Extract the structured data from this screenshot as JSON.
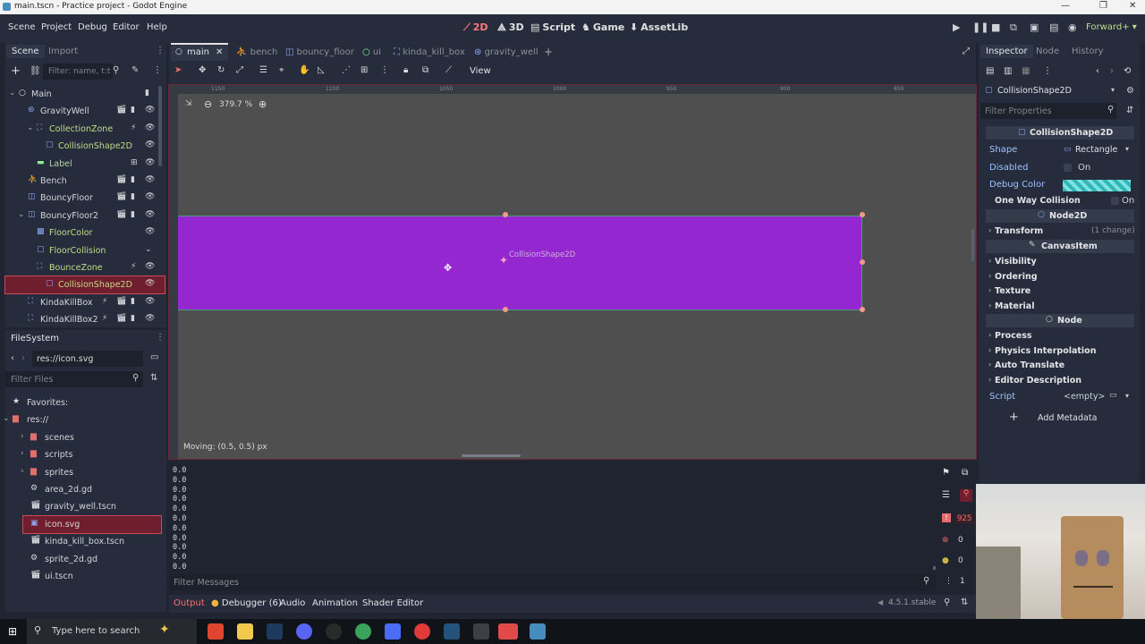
{
  "title_bar": {
    "title": "main.tscn - Practice project - Godot Engine"
  },
  "menu": [
    "Scene",
    "Project",
    "Debug",
    "Editor",
    "Help"
  ],
  "workspaces": [
    {
      "icon": "2D-icon",
      "label": "2D",
      "active": true
    },
    {
      "icon": "3D-icon",
      "label": "3D"
    },
    {
      "icon": "script-icon",
      "label": "Script"
    },
    {
      "icon": "game-icon",
      "label": "Game"
    },
    {
      "icon": "assetlib-icon",
      "label": "AssetLib"
    }
  ],
  "renderer": "Forward+",
  "scene_panel": {
    "tabs": [
      "Scene",
      "Import"
    ],
    "filter_placeholder": "Filter: name, t:t",
    "nodes": [
      {
        "label": "Main",
        "depth": 0,
        "icon_color": "#e0e0e0"
      },
      {
        "label": "GravityWell",
        "depth": 1,
        "icon_color": "#8da5f3"
      },
      {
        "label": "CollectionZone",
        "depth": 2,
        "icon_color": "#8da5f3",
        "accent": true
      },
      {
        "label": "CollisionShape2D",
        "depth": 3,
        "icon_color": "#8da5f3",
        "accent": true
      },
      {
        "label": "Label",
        "depth": 2,
        "icon_color": "#8eef97",
        "accent": true
      },
      {
        "label": "Bench",
        "depth": 1,
        "icon_color": "#8da5f3"
      },
      {
        "label": "BouncyFloor",
        "depth": 1,
        "icon_color": "#8da5f3"
      },
      {
        "label": "BouncyFloor2",
        "depth": 1,
        "icon_color": "#8da5f3"
      },
      {
        "label": "FloorColor",
        "depth": 2,
        "icon_color": "#8da5f3",
        "accent": true
      },
      {
        "label": "FloorCollision",
        "depth": 2,
        "icon_color": "#8da5f3",
        "accent": true
      },
      {
        "label": "BounceZone",
        "depth": 2,
        "icon_color": "#8da5f3",
        "accent": true
      },
      {
        "label": "CollisionShape2D",
        "depth": 3,
        "icon_color": "#8da5f3",
        "accent": true,
        "selected": true
      },
      {
        "label": "KindaKillBox",
        "depth": 1,
        "icon_color": "#8da5f3"
      },
      {
        "label": "KindaKillBox2",
        "depth": 1,
        "icon_color": "#8da5f3"
      }
    ]
  },
  "filesystem": {
    "title": "FileSystem",
    "path": "res://icon.svg",
    "filter_placeholder": "Filter Files",
    "items": [
      {
        "label": "Favorites:",
        "depth": 0,
        "icon": "star-icon"
      },
      {
        "label": "res://",
        "depth": 0,
        "icon": "folder-icon"
      },
      {
        "label": "scenes",
        "depth": 1,
        "icon": "folder-icon"
      },
      {
        "label": "scripts",
        "depth": 1,
        "icon": "folder-icon"
      },
      {
        "label": "sprites",
        "depth": 1,
        "icon": "folder-icon"
      },
      {
        "label": "area_2d.gd",
        "depth": 1,
        "icon": "gear-icon"
      },
      {
        "label": "gravity_well.tscn",
        "depth": 1,
        "icon": "scene-icon"
      },
      {
        "label": "icon.svg",
        "depth": 1,
        "icon": "image-icon",
        "selected": true
      },
      {
        "label": "kinda_kill_box.tscn",
        "depth": 1,
        "icon": "scene-icon"
      },
      {
        "label": "sprite_2d.gd",
        "depth": 1,
        "icon": "gear-icon"
      },
      {
        "label": "ui.tscn",
        "depth": 1,
        "icon": "scene-icon"
      }
    ]
  },
  "scene_tabs": [
    "main",
    "bench",
    "bouncy_floor",
    "ui",
    "kinda_kill_box",
    "gravity_well"
  ],
  "toolbar": {
    "view_label": "View"
  },
  "viewport": {
    "zoom": "379.7 %",
    "ruler_labels": [
      "1150",
      "1100",
      "1050",
      "1000",
      "950",
      "900",
      "850"
    ],
    "shape_label": "CollisionShape2D",
    "status": "Moving: (0.5, 0.5) px",
    "shape_color": "#9527d1"
  },
  "inspector": {
    "tabs": [
      "Inspector",
      "Node",
      "History"
    ],
    "object": "CollisionShape2D",
    "filter_placeholder": "Filter Properties",
    "header": "CollisionShape2D",
    "shape_label": "Shape",
    "shape_value": "Rectangle",
    "disabled_label": "Disabled",
    "disabled_value": "On",
    "debug_color_label": "Debug Color",
    "one_way_label": "One Way Collision",
    "one_way_value": "On",
    "node2d_header": "Node2D",
    "transform_label": "Transform",
    "transform_changes": "(1 change)",
    "canvasitem_header": "CanvasItem",
    "canvasitem_sections": [
      "Visibility",
      "Ordering",
      "Texture",
      "Material"
    ],
    "node_header": "Node",
    "node_sections": [
      "Process",
      "Physics Interpolation",
      "Auto Translate",
      "Editor Description"
    ],
    "script_label": "Script",
    "script_value": "<empty>",
    "add_metadata": "Add Metadata"
  },
  "output": {
    "lines": [
      "0.0",
      "0.0",
      "0.0",
      "0.0",
      "0.0",
      "0.0",
      "0.0",
      "0.0",
      "0.0",
      "0.0",
      "0.0"
    ],
    "filter_placeholder": "Filter Messages",
    "counts": {
      "errors": "925",
      "warnings": "0",
      "info": "0",
      "other": "1"
    }
  },
  "bottom_tabs": [
    "Output",
    "Debugger (6)",
    "Audio",
    "Animation",
    "Shader Editor"
  ],
  "version": "4.5.1.stable",
  "taskbar": {
    "search_placeholder": "Type here to search"
  }
}
